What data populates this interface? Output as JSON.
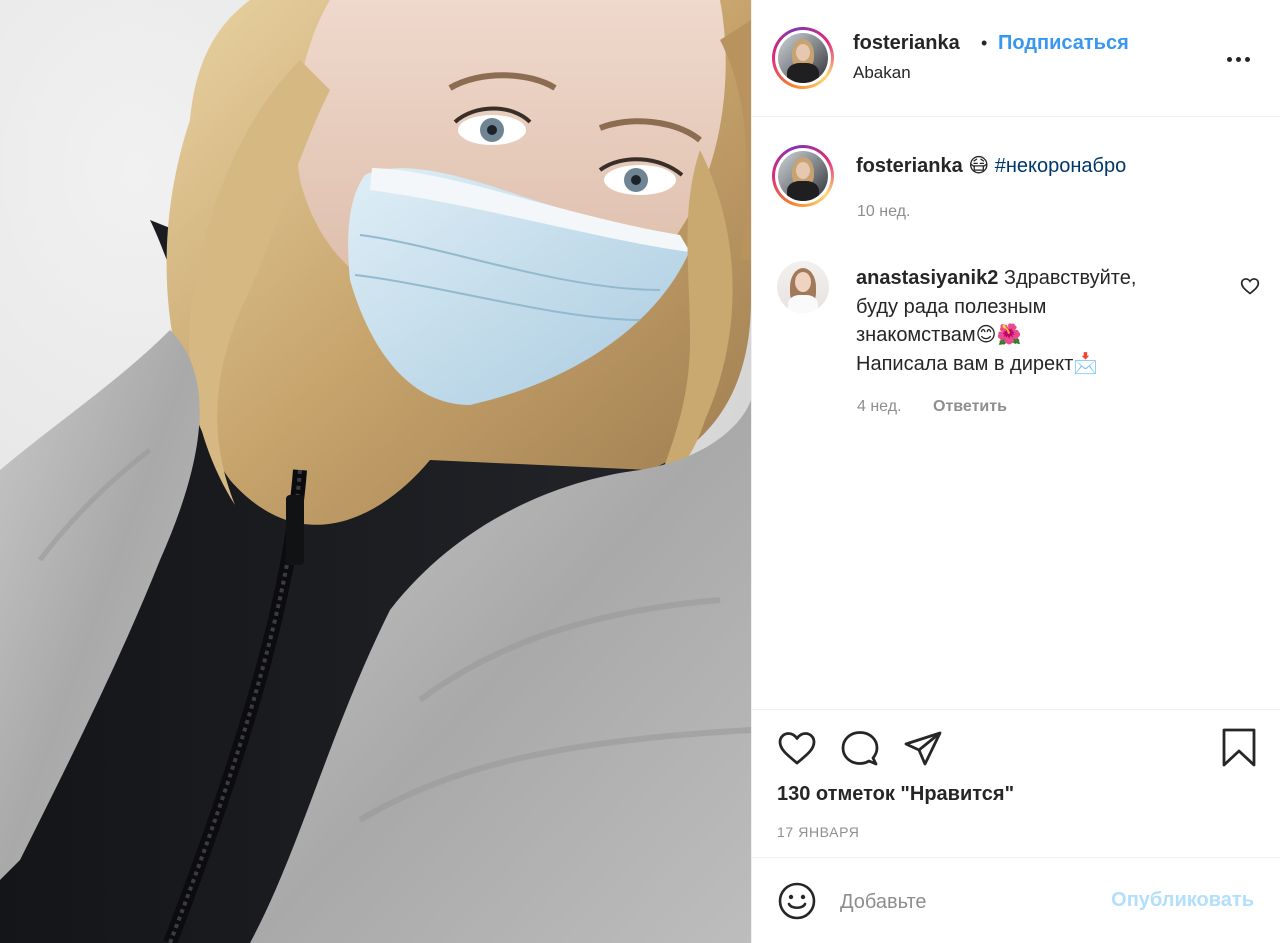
{
  "header": {
    "username": "fosterianka",
    "separator": "•",
    "follow_label": "Подписаться",
    "location": "Abakan"
  },
  "caption": {
    "username": "fosterianka",
    "emoji": "😷",
    "hashtag": "#некоронабро",
    "time": "10 нед."
  },
  "comments": [
    {
      "username": "anastasiyanik2",
      "text_line1": "Здравствуйте,",
      "text_line2": "буду рада полезным",
      "text_line3": "знакомствам😊🌺",
      "text_line4": "Написала вам в директ📩",
      "time": "4 нед.",
      "reply_label": "Ответить"
    }
  ],
  "actions": {
    "likes_text": "130 отметок \"Нравится\"",
    "date": "17 ЯНВАРЯ"
  },
  "add_comment": {
    "placeholder": "Добавьте",
    "post_label": "Опубликовать"
  },
  "icons": {
    "like": "heart-icon",
    "comment": "comment-bubble-icon",
    "share": "paper-plane-icon",
    "save": "bookmark-icon",
    "more": "more-options-icon",
    "emoji": "smiley-icon"
  },
  "colors": {
    "accent": "#3897f0",
    "hashtag": "#00376b",
    "muted": "#8e8e8e",
    "post_disabled": "#b2dffc"
  }
}
